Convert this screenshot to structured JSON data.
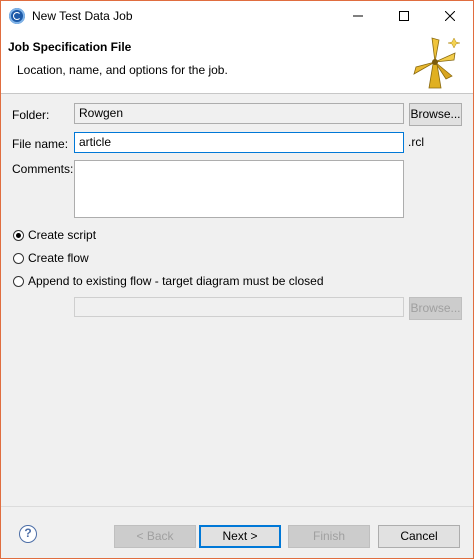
{
  "window": {
    "title": "New Test Data Job",
    "accent_border": "#e06d3f"
  },
  "banner": {
    "title": "Job Specification File",
    "description": "Location, name, and options for the job."
  },
  "form": {
    "folder_label": "Folder:",
    "folder_value": "Rowgen",
    "browse_label": "Browse...",
    "file_name_label": "File name:",
    "file_name_value": "article",
    "file_suffix": ".rcl",
    "comments_label": "Comments:",
    "comments_value": ""
  },
  "options": {
    "create_script": "Create script",
    "create_flow": "Create flow",
    "append_flow": "Append to existing flow - target diagram must be closed",
    "selected": "create_script",
    "append_browse_label": "Browse..."
  },
  "footer": {
    "back_label": "< Back",
    "next_label": "Next >",
    "finish_label": "Finish",
    "cancel_label": "Cancel"
  },
  "icons": {
    "app": "app-logo-icon",
    "minimize": "minimize-icon",
    "maximize": "maximize-icon",
    "close": "close-icon",
    "wizard": "windmill-icon",
    "help": "help-icon"
  }
}
